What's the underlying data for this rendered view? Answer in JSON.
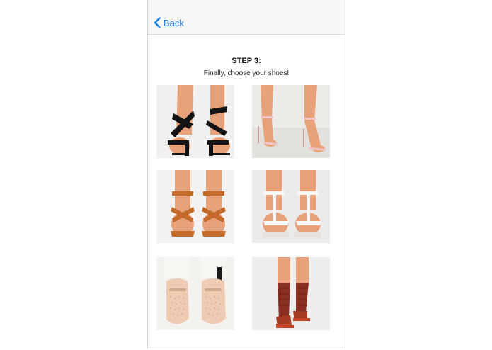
{
  "nav": {
    "back_label": "Back"
  },
  "step": {
    "title": "STEP 3:",
    "subtitle": "Finally, choose your shoes!"
  },
  "shoes": [
    {
      "name": "black-strappy-sandal",
      "style": "black strappy block-heel sandal"
    },
    {
      "name": "pink-ankle-strap-heel",
      "style": "blush ankle-strap stiletto"
    },
    {
      "name": "tan-gladiator-sandal",
      "style": "tan cross-strap flat sandal"
    },
    {
      "name": "white-t-strap-sandal",
      "style": "white T-strap flat sandal"
    },
    {
      "name": "studded-loafer",
      "style": "blush studded loafer"
    },
    {
      "name": "burgundy-sock-boot",
      "style": "burgundy sock bootie"
    }
  ],
  "colors": {
    "accent": "#1a7cf2",
    "navbar": "#f7f7f7",
    "skin": "#e8a27a"
  }
}
